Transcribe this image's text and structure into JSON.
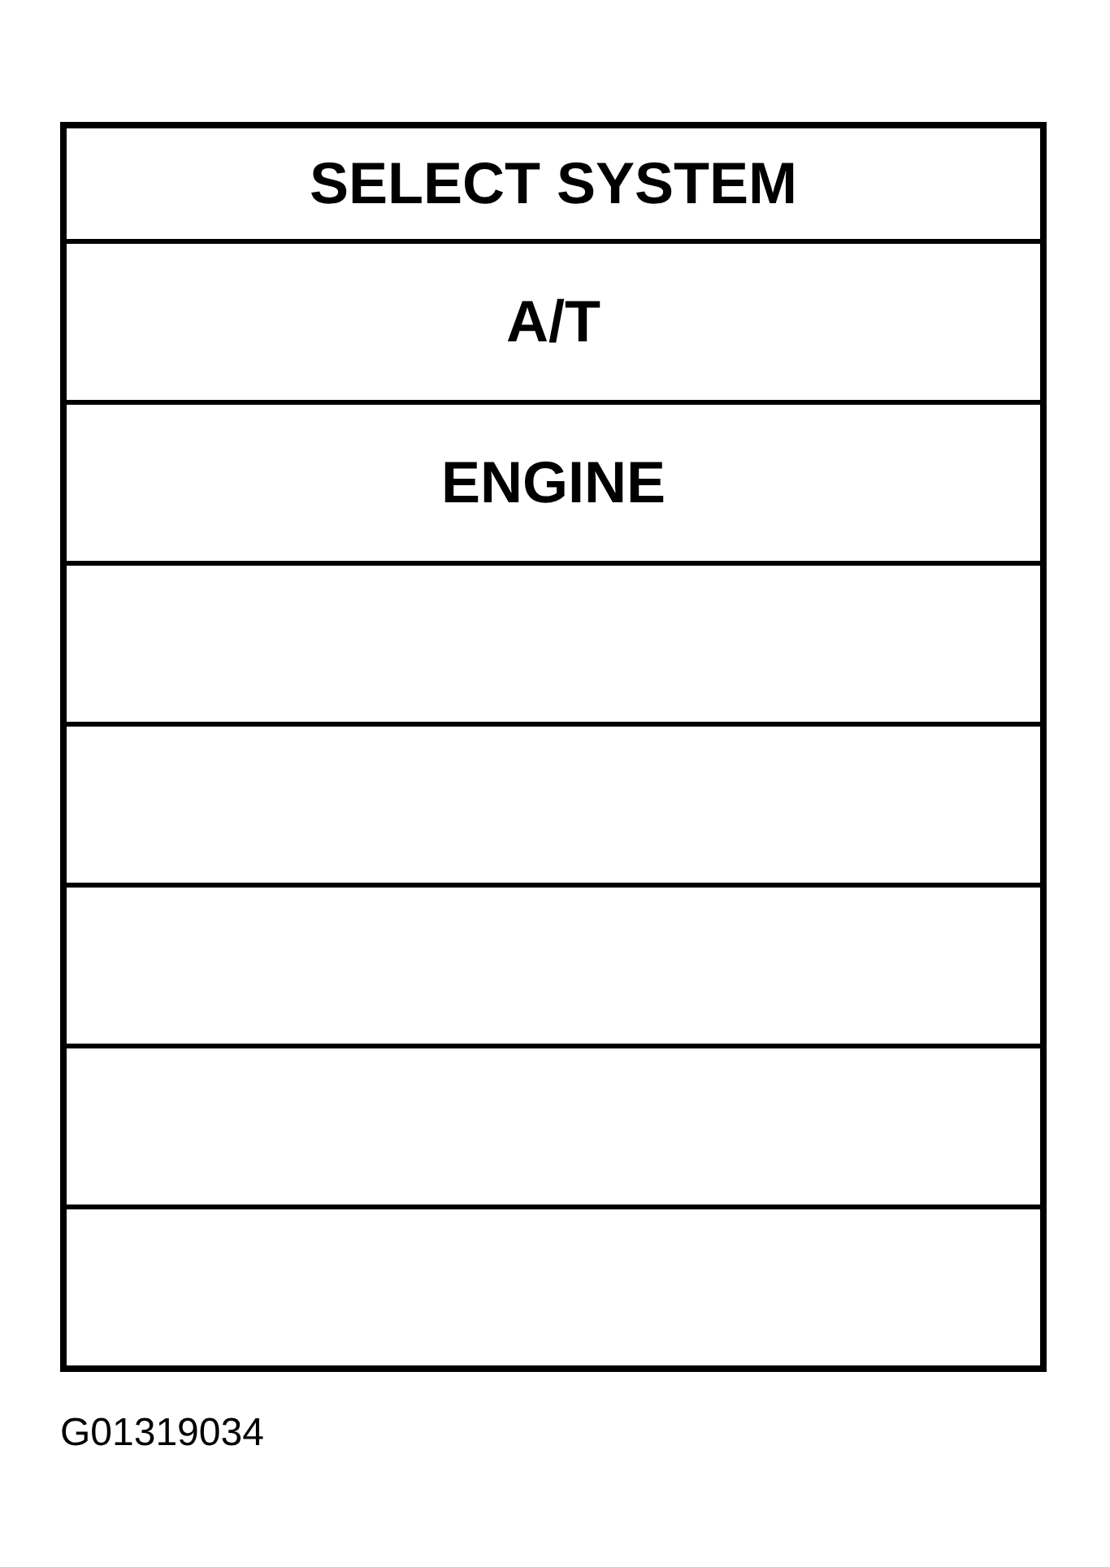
{
  "menu": {
    "title": "SELECT SYSTEM",
    "rows": [
      {
        "kind": "option",
        "label": "A/T"
      },
      {
        "kind": "option",
        "label": "ENGINE"
      },
      {
        "kind": "blank"
      },
      {
        "kind": "blank"
      },
      {
        "kind": "blank"
      },
      {
        "kind": "blank"
      },
      {
        "kind": "blank"
      }
    ]
  },
  "figure_id": "G01319034"
}
